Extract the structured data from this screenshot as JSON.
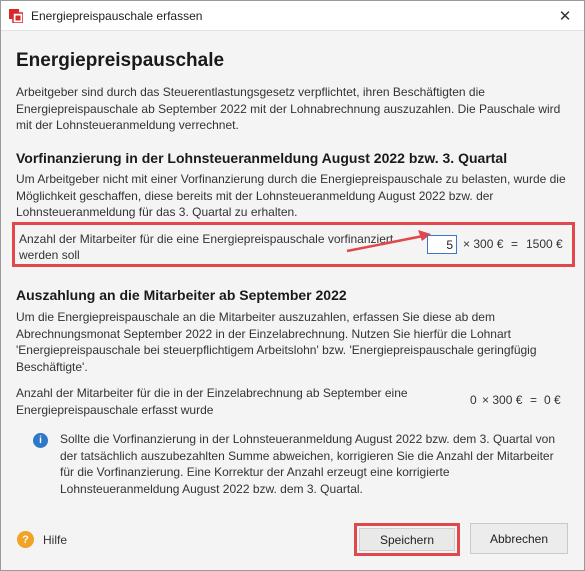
{
  "window": {
    "title": "Energiepreispauschale erfassen",
    "close_symbol": "✕"
  },
  "main": {
    "heading": "Energiepreispauschale",
    "intro": "Arbeitgeber sind durch das Steuerentlastungsgesetz verpflichtet, ihren Beschäftigten die Energiepreispauschale ab September 2022 mit der Lohnabrechnung auszuzahlen. Die Pauschale wird mit der Lohnsteueranmeldung verrechnet."
  },
  "prefinancing": {
    "title": "Vorfinanzierung in der Lohnsteueranmeldung August 2022 bzw. 3. Quartal",
    "text": "Um Arbeitgeber nicht mit einer Vorfinanzierung durch die Energiepreispauschale zu belasten, wurde die Möglichkeit geschaffen, diese bereits mit der Lohnsteueranmeldung August 2022 bzw. der Lohnsteueranmeldung für das 3. Quartal zu erhalten.",
    "row_label": "Anzahl der Mitarbeiter für die eine Energiepreispauschale vorfinanziert werden soll",
    "count_value": "5",
    "multiplier": "× 300 €",
    "equals": "=",
    "result": "1500 €"
  },
  "payout": {
    "title": "Auszahlung an die Mitarbeiter ab September 2022",
    "text": "Um die Energiepreispauschale an die Mitarbeiter auszuzahlen, erfassen Sie diese ab dem Abrechnungsmonat September 2022 in der Einzelabrechnung. Nutzen Sie hierfür die Lohnart 'Energiepreispauschale bei steuerpflichtigem Arbeitslohn' bzw. 'Energiepreispauschale geringfügig Beschäftigte'.",
    "row_label": "Anzahl der Mitarbeiter für die in der Einzelabrechnung ab September eine Energiepreispauschale erfasst wurde",
    "count": "0",
    "multiplier": "× 300 €",
    "equals": "=",
    "result": "0 €"
  },
  "info": {
    "icon_symbol": "i",
    "text": "Sollte die Vorfinanzierung in der Lohnsteueranmeldung August 2022 bzw. dem 3. Quartal von der tatsächlich auszubezahlten Summe abweichen, korrigieren Sie die Anzahl der Mitarbeiter für die Vorfinanzierung. Eine Korrektur der Anzahl erzeugt eine korrigierte Lohnsteueranmeldung August 2022 bzw. dem 3. Quartal."
  },
  "footer": {
    "help_symbol": "?",
    "help_label": "Hilfe",
    "save_label": "Speichern",
    "cancel_label": "Abbrechen"
  },
  "colors": {
    "highlight": "#e0484c",
    "info_blue": "#2f78c8",
    "help_orange": "#f0a325",
    "app_icon_red": "#d8282c"
  },
  "icons": [
    "app-logo-icon",
    "close-icon",
    "arrow-icon",
    "info-icon",
    "help-icon"
  ]
}
